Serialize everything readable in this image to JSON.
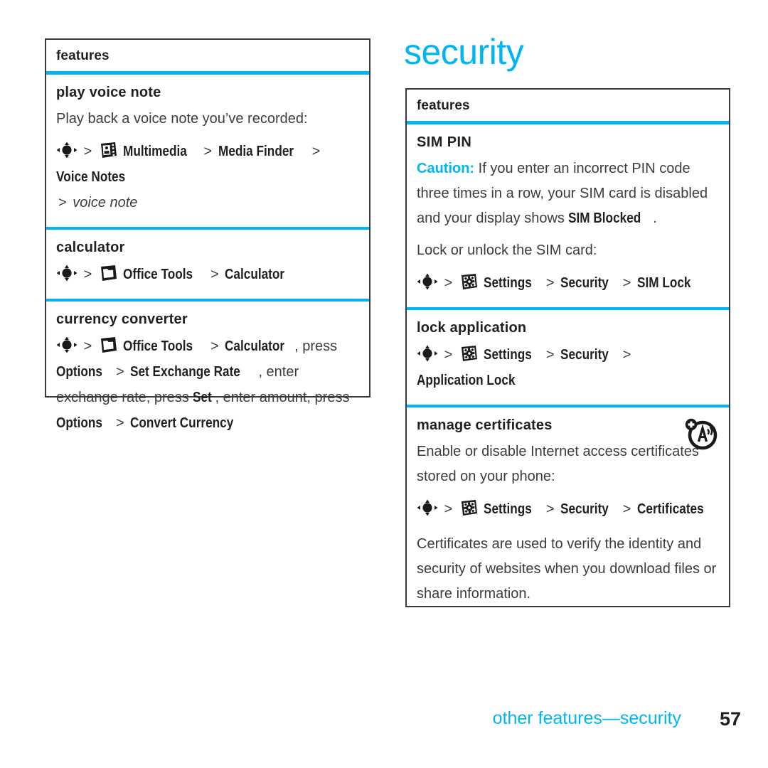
{
  "page": {
    "title": "security",
    "footer_label": "other features—security",
    "page_number": "57",
    "accent_color": "#00b5f0",
    "text_color": "#3c3c3c",
    "heading_color": "#231f20"
  },
  "left_panel": {
    "head_label": "features",
    "sections": [
      {
        "title": "play voice note",
        "intro": "Play back a voice note you’ve recorded:",
        "path": {
          "nav_icon": "navigation-key-icon",
          "sep": ">",
          "app_icon": "multimedia-icon",
          "items": [
            "Multimedia",
            "Media Finder",
            "Voice Notes"
          ],
          "trailing_sep": ">",
          "trailing_italic": "voice note"
        }
      },
      {
        "title": "calculator",
        "path": {
          "nav_icon": "navigation-key-icon",
          "sep": ">",
          "app_icon": "office-tools-icon",
          "items": [
            "Office Tools",
            "Calculator"
          ]
        }
      },
      {
        "title": "currency converter",
        "path_line1_pre": "",
        "path": {
          "nav_icon": "navigation-key-icon",
          "sep": ">",
          "app_icon": "office-tools-icon",
          "items": [
            "Office Tools",
            "Calculator"
          ]
        },
        "path_tail": [
          {
            "plain": ", press "
          },
          {
            "ui": "Options"
          },
          {
            "plain": " "
          },
          {
            "sep": ">"
          },
          {
            "plain": " "
          },
          {
            "ui": "Set Exchange Rate"
          },
          {
            "plain": ", enter exchange rate, press "
          },
          {
            "ui": "Set"
          },
          {
            "plain": ", enter amount, press "
          },
          {
            "ui": "Options"
          },
          {
            "plain": " "
          },
          {
            "sep": ">"
          },
          {
            "plain": " "
          },
          {
            "ui": "Convert Currency"
          }
        ]
      }
    ]
  },
  "right_panel": {
    "head_label": "features",
    "sections": [
      {
        "title": "SIM PIN",
        "caution_label": "Caution:",
        "caution_body_1": " If you enter an incorrect PIN code three times in a row, your SIM card is disabled and your display shows ",
        "caution_ui": "SIM Blocked",
        "caution_body_2": ".",
        "intro": "Lock or unlock the SIM card:",
        "path": {
          "nav_icon": "navigation-key-icon",
          "sep": ">",
          "app_icon": "settings-icon",
          "items": [
            "Settings",
            "Security",
            "SIM Lock"
          ]
        }
      },
      {
        "title": "lock application",
        "path": {
          "nav_icon": "navigation-key-icon",
          "sep": ">",
          "app_icon": "settings-icon",
          "items": [
            "Settings",
            "Security",
            "Application Lock"
          ]
        }
      },
      {
        "title": "manage certificates",
        "badge_icon": "certificate-network-icon",
        "intro": "Enable or disable Internet access certificates stored on your phone:",
        "path": {
          "nav_icon": "navigation-key-icon",
          "sep": ">",
          "app_icon": "settings-icon",
          "items": [
            "Settings",
            "Security",
            "Certificates"
          ]
        },
        "outro": "Certificates are used to verify the identity and security of websites when you download files or share information."
      }
    ]
  }
}
